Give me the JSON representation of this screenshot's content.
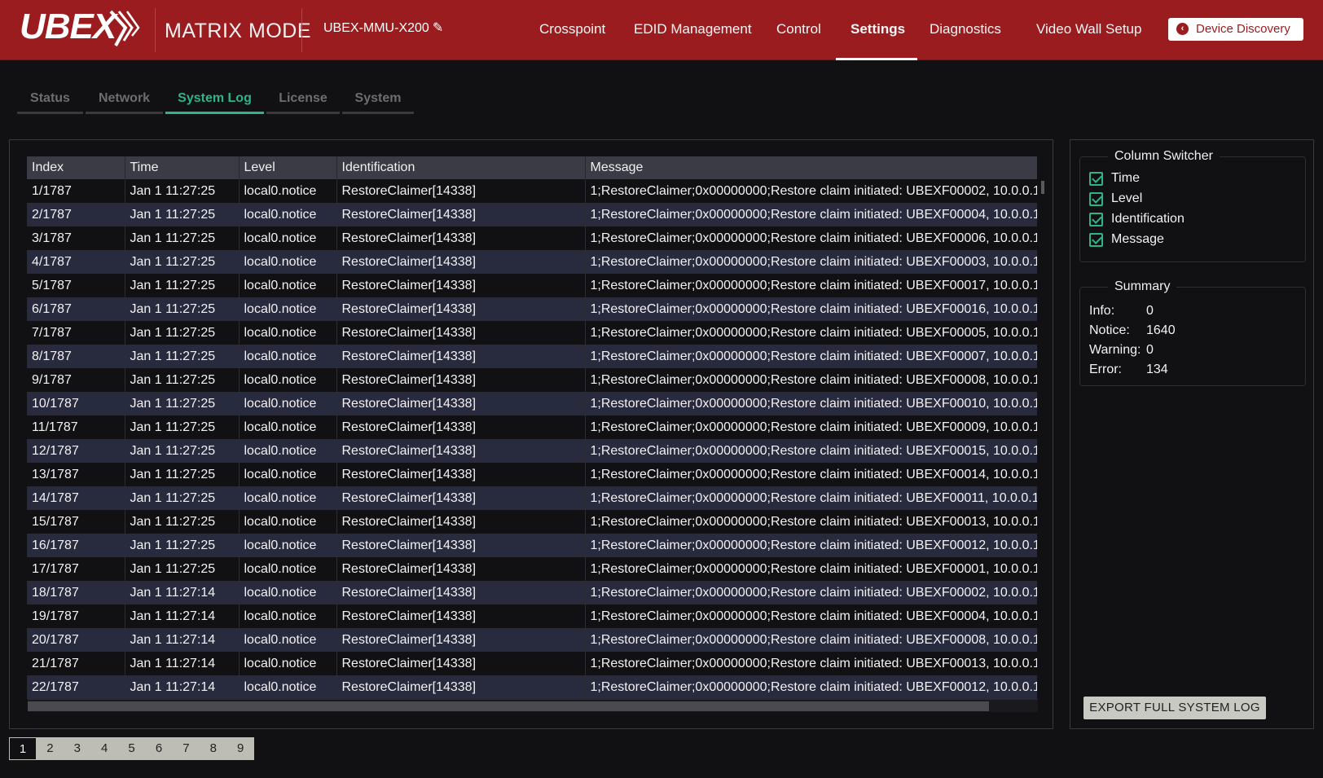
{
  "header": {
    "logo": "UBEX",
    "mode": "MATRIX MODE",
    "device_name": "UBEX-MMU-X200",
    "nav": [
      {
        "label": "Crosspoint"
      },
      {
        "label": "EDID Management"
      },
      {
        "label": "Control"
      },
      {
        "label": "Settings",
        "active": true
      },
      {
        "label": "Diagnostics"
      },
      {
        "label": "Video Wall Setup"
      }
    ],
    "discovery_label": "Device Discovery"
  },
  "subtabs": [
    {
      "label": "Status"
    },
    {
      "label": "Network"
    },
    {
      "label": "System Log",
      "active": true
    },
    {
      "label": "License"
    },
    {
      "label": "System"
    }
  ],
  "log_table": {
    "columns": [
      "Index",
      "Time",
      "Level",
      "Identification",
      "Message"
    ],
    "rows": [
      [
        "1/1787",
        "Jan 1 11:27:25",
        "local0.notice",
        "RestoreClaimer[14338]",
        "1;RestoreClaimer;0x00000000;Restore claim initiated: UBEXF00002, 10.0.0.1"
      ],
      [
        "2/1787",
        "Jan 1 11:27:25",
        "local0.notice",
        "RestoreClaimer[14338]",
        "1;RestoreClaimer;0x00000000;Restore claim initiated: UBEXF00004, 10.0.0.1"
      ],
      [
        "3/1787",
        "Jan 1 11:27:25",
        "local0.notice",
        "RestoreClaimer[14338]",
        "1;RestoreClaimer;0x00000000;Restore claim initiated: UBEXF00006, 10.0.0.1"
      ],
      [
        "4/1787",
        "Jan 1 11:27:25",
        "local0.notice",
        "RestoreClaimer[14338]",
        "1;RestoreClaimer;0x00000000;Restore claim initiated: UBEXF00003, 10.0.0.1"
      ],
      [
        "5/1787",
        "Jan 1 11:27:25",
        "local0.notice",
        "RestoreClaimer[14338]",
        "1;RestoreClaimer;0x00000000;Restore claim initiated: UBEXF00017, 10.0.0.1"
      ],
      [
        "6/1787",
        "Jan 1 11:27:25",
        "local0.notice",
        "RestoreClaimer[14338]",
        "1;RestoreClaimer;0x00000000;Restore claim initiated: UBEXF00016, 10.0.0.1"
      ],
      [
        "7/1787",
        "Jan 1 11:27:25",
        "local0.notice",
        "RestoreClaimer[14338]",
        "1;RestoreClaimer;0x00000000;Restore claim initiated: UBEXF00005, 10.0.0.1"
      ],
      [
        "8/1787",
        "Jan 1 11:27:25",
        "local0.notice",
        "RestoreClaimer[14338]",
        "1;RestoreClaimer;0x00000000;Restore claim initiated: UBEXF00007, 10.0.0.1"
      ],
      [
        "9/1787",
        "Jan 1 11:27:25",
        "local0.notice",
        "RestoreClaimer[14338]",
        "1;RestoreClaimer;0x00000000;Restore claim initiated: UBEXF00008, 10.0.0.1"
      ],
      [
        "10/1787",
        "Jan 1 11:27:25",
        "local0.notice",
        "RestoreClaimer[14338]",
        "1;RestoreClaimer;0x00000000;Restore claim initiated: UBEXF00010, 10.0.0.1"
      ],
      [
        "11/1787",
        "Jan 1 11:27:25",
        "local0.notice",
        "RestoreClaimer[14338]",
        "1;RestoreClaimer;0x00000000;Restore claim initiated: UBEXF00009, 10.0.0.1"
      ],
      [
        "12/1787",
        "Jan 1 11:27:25",
        "local0.notice",
        "RestoreClaimer[14338]",
        "1;RestoreClaimer;0x00000000;Restore claim initiated: UBEXF00015, 10.0.0.1"
      ],
      [
        "13/1787",
        "Jan 1 11:27:25",
        "local0.notice",
        "RestoreClaimer[14338]",
        "1;RestoreClaimer;0x00000000;Restore claim initiated: UBEXF00014, 10.0.0.1"
      ],
      [
        "14/1787",
        "Jan 1 11:27:25",
        "local0.notice",
        "RestoreClaimer[14338]",
        "1;RestoreClaimer;0x00000000;Restore claim initiated: UBEXF00011, 10.0.0.1"
      ],
      [
        "15/1787",
        "Jan 1 11:27:25",
        "local0.notice",
        "RestoreClaimer[14338]",
        "1;RestoreClaimer;0x00000000;Restore claim initiated: UBEXF00013, 10.0.0.1"
      ],
      [
        "16/1787",
        "Jan 1 11:27:25",
        "local0.notice",
        "RestoreClaimer[14338]",
        "1;RestoreClaimer;0x00000000;Restore claim initiated: UBEXF00012, 10.0.0.1"
      ],
      [
        "17/1787",
        "Jan 1 11:27:25",
        "local0.notice",
        "RestoreClaimer[14338]",
        "1;RestoreClaimer;0x00000000;Restore claim initiated: UBEXF00001, 10.0.0.1"
      ],
      [
        "18/1787",
        "Jan 1 11:27:14",
        "local0.notice",
        "RestoreClaimer[14338]",
        "1;RestoreClaimer;0x00000000;Restore claim initiated: UBEXF00002, 10.0.0.1"
      ],
      [
        "19/1787",
        "Jan 1 11:27:14",
        "local0.notice",
        "RestoreClaimer[14338]",
        "1;RestoreClaimer;0x00000000;Restore claim initiated: UBEXF00004, 10.0.0.1"
      ],
      [
        "20/1787",
        "Jan 1 11:27:14",
        "local0.notice",
        "RestoreClaimer[14338]",
        "1;RestoreClaimer;0x00000000;Restore claim initiated: UBEXF00008, 10.0.0.1"
      ],
      [
        "21/1787",
        "Jan 1 11:27:14",
        "local0.notice",
        "RestoreClaimer[14338]",
        "1;RestoreClaimer;0x00000000;Restore claim initiated: UBEXF00013, 10.0.0.1"
      ],
      [
        "22/1787",
        "Jan 1 11:27:14",
        "local0.notice",
        "RestoreClaimer[14338]",
        "1;RestoreClaimer;0x00000000;Restore claim initiated: UBEXF00012, 10.0.0.1"
      ]
    ]
  },
  "column_switcher": {
    "title": "Column Switcher",
    "items": [
      {
        "label": "Time",
        "checked": true
      },
      {
        "label": "Level",
        "checked": true
      },
      {
        "label": "Identification",
        "checked": true
      },
      {
        "label": "Message",
        "checked": true
      }
    ]
  },
  "summary": {
    "title": "Summary",
    "items": [
      {
        "key": "Info:",
        "value": "0"
      },
      {
        "key": "Notice:",
        "value": "1640"
      },
      {
        "key": "Warning:",
        "value": "0"
      },
      {
        "key": "Error:",
        "value": "134"
      }
    ]
  },
  "export_label": "EXPORT FULL SYSTEM LOG",
  "pagination": {
    "pages": [
      "1",
      "2",
      "3",
      "4",
      "5",
      "6",
      "7",
      "8",
      "9"
    ],
    "current": "1"
  },
  "colors": {
    "header_bg": "#9b1c1f",
    "accent": "#2fb38a",
    "row_even": "#282a3d",
    "page_bg": "#111114"
  }
}
